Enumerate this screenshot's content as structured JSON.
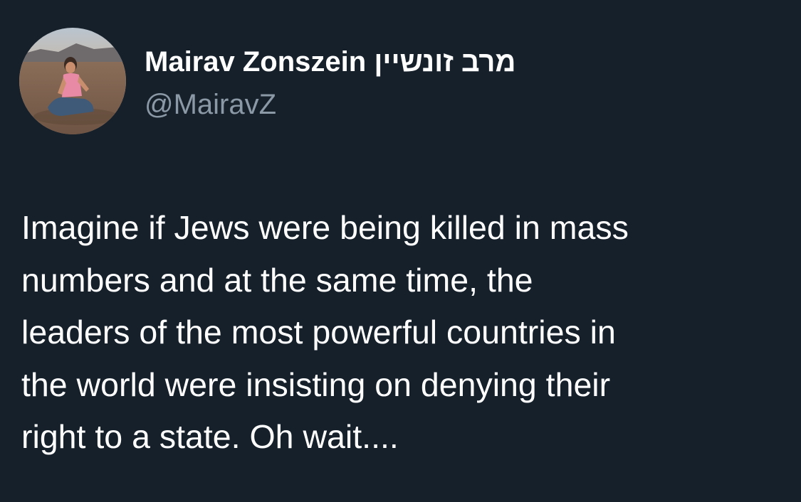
{
  "tweet": {
    "author": {
      "display_name": "Mairav Zonszein מרב זונשיין",
      "handle": "@MairavZ",
      "avatar_icon": "profile-photo-avatar"
    },
    "text_lines": [
      "Imagine if Jews were being killed in mass",
      "numbers and at the same time, the",
      "leaders of the most powerful countries in",
      "the world were insisting on denying their",
      "right to a state. Oh wait...."
    ]
  },
  "colors": {
    "background": "#16202b",
    "primary_text": "#ffffff",
    "secondary_text": "#8b98a5"
  }
}
